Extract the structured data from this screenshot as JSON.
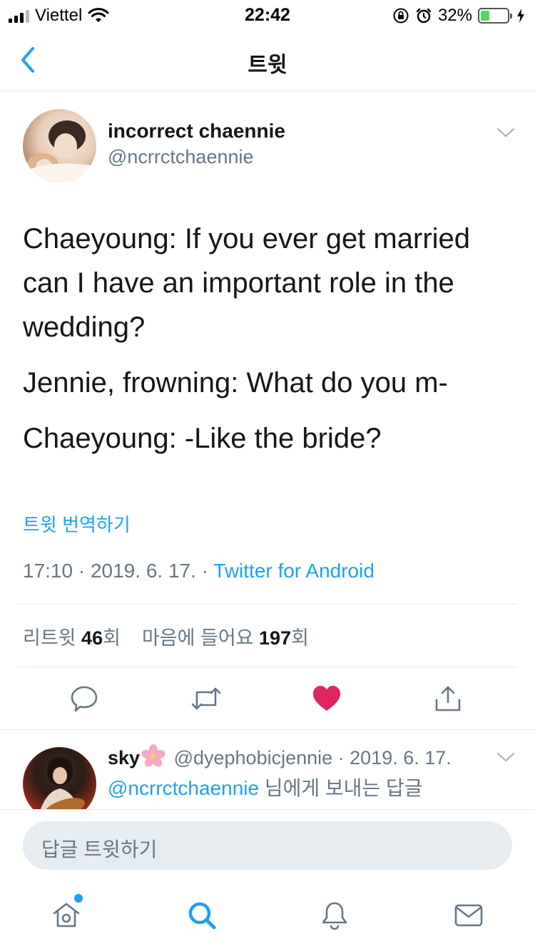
{
  "status_bar": {
    "carrier": "Viettel",
    "time": "22:42",
    "battery_percent": "32%",
    "battery_level": 0.32,
    "icons": [
      "signal-icon",
      "wifi-icon",
      "rotation-lock-icon",
      "alarm-icon",
      "battery-icon",
      "charging-icon"
    ]
  },
  "nav": {
    "title": "트윗",
    "back_icon": "chevron-left-icon"
  },
  "tweet": {
    "author_name": "incorrect chaennie",
    "author_handle": "@ncrrctchaennie",
    "text_lines": [
      "Chaeyoung: If you ever get married can I have an important role in the wedding?",
      "Jennie, frowning: What do you m-",
      "Chaeyoung: -Like the bride?"
    ],
    "translate_label": "트윗 번역하기",
    "time": "17:10",
    "date": "2019. 6. 17.",
    "separator": " · ",
    "source": "Twitter for Android",
    "retweet_label": "리트윗",
    "retweet_count": "46",
    "count_suffix": "회",
    "like_label": "마음에 들어요",
    "like_count": "197"
  },
  "actions": {
    "icons": [
      "reply-icon",
      "retweet-icon",
      "like-icon",
      "share-icon"
    ],
    "like_color": "#e0245e"
  },
  "reply": {
    "name": "sky",
    "emoji": "🌸",
    "handle": "@dyephobicjennie",
    "date": "2019. 6. 17.",
    "mention": "@ncrrctchaennie",
    "reply_suffix": " 님에게 보내는 답글"
  },
  "compose": {
    "placeholder": "답글 트윗하기"
  },
  "tab_bar": {
    "icons": [
      "home-icon",
      "search-icon",
      "notifications-icon",
      "messages-icon"
    ],
    "accent": "#1da1f2"
  }
}
